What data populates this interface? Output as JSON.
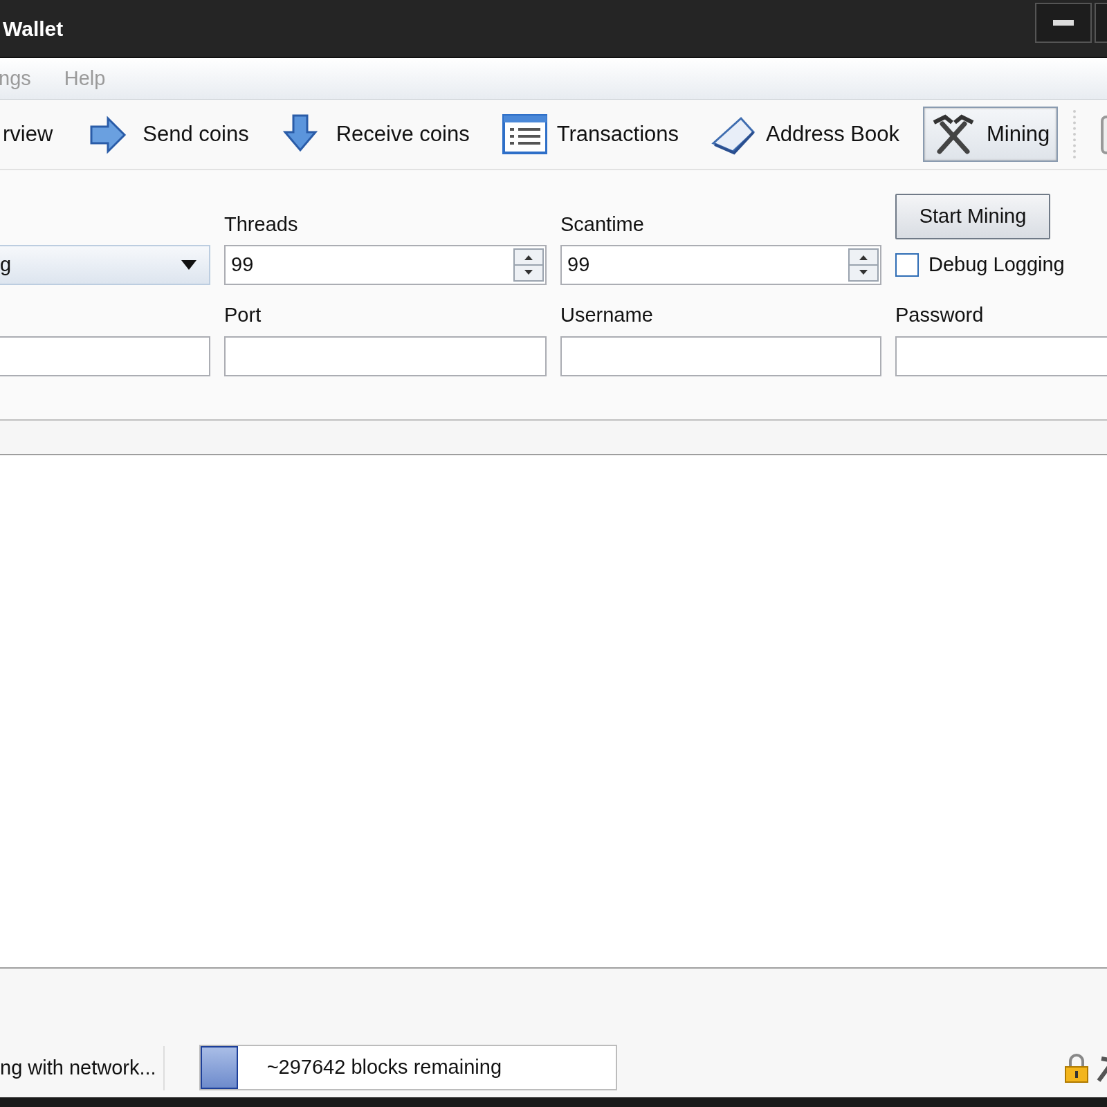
{
  "window": {
    "title": "Wallet"
  },
  "menu": [
    {
      "label": "ngs"
    },
    {
      "label": "Help"
    }
  ],
  "toolbar": [
    {
      "kind": "text",
      "label": "rview",
      "selected": false
    },
    {
      "kind": "send",
      "label": "Send coins",
      "selected": false
    },
    {
      "kind": "receive",
      "label": "Receive coins",
      "selected": false
    },
    {
      "kind": "list",
      "label": "Transactions",
      "selected": false
    },
    {
      "kind": "book",
      "label": "Address Book",
      "selected": false
    },
    {
      "kind": "mining",
      "label": "Mining",
      "selected": true
    }
  ],
  "mining_form": {
    "mode_dropdown": {
      "value": "g"
    },
    "threads": {
      "label": "Threads",
      "value": "99"
    },
    "scantime": {
      "label": "Scantime",
      "value": "99"
    },
    "start_button": "Start Mining",
    "debug_logging": {
      "label": "Debug Logging",
      "checked": false
    },
    "connection_labels": [
      "Port",
      "Username",
      "Password"
    ]
  },
  "status_bar": {
    "sync_text": "ng with network...",
    "progress": {
      "level": 0.09,
      "text": "~297642 blocks remaining"
    }
  }
}
